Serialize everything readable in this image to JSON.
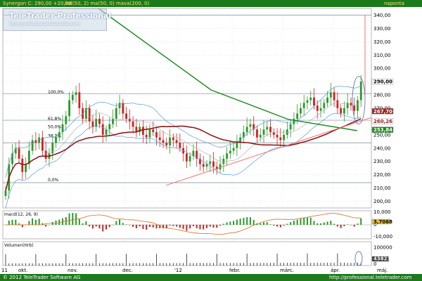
{
  "header": {
    "instrument": "Synergon C: 290,00 +20,00",
    "indicators": "ind(50, 2) ma(50, 0) mava(200, 0)",
    "period": "napontа"
  },
  "watermark": {
    "brand": "TeleTrader Professional",
    "url": "http://professional.teletrader.com"
  },
  "footer": {
    "copyright": "© 2012 TeleTrader Software AG",
    "url": "http://professional.teletrader.com"
  },
  "colors": {
    "bar_up": "#2a9a2a",
    "bar_down": "#d02020",
    "trend_green": "#1a8a1a",
    "ma_dark": "#8b1a1a",
    "bollinger": "#5a9ad0",
    "trendline": "#f07070",
    "grid": "#d8d8d8"
  },
  "chart_data": [
    {
      "type": "candlestick",
      "title": "",
      "ylim": [
        195,
        345
      ],
      "yticks": [
        "200,00",
        "210,00",
        "220,00",
        "230,00",
        "240,00",
        "250,00",
        "260,00",
        "270,00",
        "280,00",
        "290,00",
        "300,00",
        "310,00",
        "320,00",
        "330,00",
        "340,00"
      ],
      "xticks": [
        "11",
        "okt.",
        "nov.",
        "dec.",
        "'12",
        "febr.",
        "márc.",
        "ápr.",
        "máj."
      ],
      "fib_levels": [
        {
          "label": "100,0%",
          "value": 280
        },
        {
          "label": "61,8%",
          "value": 260
        },
        {
          "label": "50,0%",
          "value": 254
        },
        {
          "label": "38,2%",
          "value": 247
        },
        {
          "label": "0,0%",
          "value": 214
        }
      ],
      "price_labels": [
        {
          "text": "290,00",
          "value": 290,
          "bg": "#ffffff",
          "fg": "#000000"
        },
        {
          "text": "267,70",
          "value": 267.7,
          "bg": "#a02020",
          "fg": "#ffffff"
        },
        {
          "text": "260,26",
          "value": 260.3,
          "bg": "#ffffff",
          "fg": "#8b1a1a"
        },
        {
          "text": "253,84",
          "value": 253.8,
          "bg": "#1a8a1a",
          "fg": "#ffffff"
        }
      ],
      "horizontal_lines": [
        281,
        340,
        261,
        244,
        214
      ],
      "closes": [
        208,
        228,
        236,
        240,
        232,
        222,
        228,
        238,
        246,
        244,
        248,
        238,
        232,
        236,
        244,
        248,
        252,
        258,
        264,
        276,
        280,
        282,
        270,
        262,
        270,
        260,
        256,
        262,
        258,
        250,
        254,
        258,
        262,
        270,
        274,
        266,
        262,
        260,
        256,
        252,
        256,
        250,
        248,
        254,
        252,
        248,
        246,
        244,
        242,
        248,
        246,
        244,
        240,
        236,
        230,
        234,
        238,
        232,
        228,
        226,
        228,
        230,
        226,
        224,
        228,
        232,
        236,
        238,
        240,
        244,
        248,
        252,
        256,
        258,
        254,
        248,
        250,
        254,
        256,
        252,
        250,
        248,
        246,
        250,
        254,
        258,
        262,
        266,
        270,
        274,
        276,
        278,
        272,
        268,
        270,
        274,
        278,
        282,
        276,
        270,
        266,
        270,
        274,
        272,
        268,
        276,
        290
      ]
    },
    {
      "type": "bar",
      "title": "macd(12, 26, 9)",
      "ylim": [
        -11000,
        11000
      ],
      "yticks": [
        "-10,000",
        "0",
        "10,000"
      ],
      "last_value": "3,7068"
    },
    {
      "type": "bar",
      "title": "Volumen(Hrb)",
      "ylim": [
        0,
        130000
      ],
      "yticks": [
        "0",
        "100000"
      ],
      "last_value": "43823"
    }
  ]
}
